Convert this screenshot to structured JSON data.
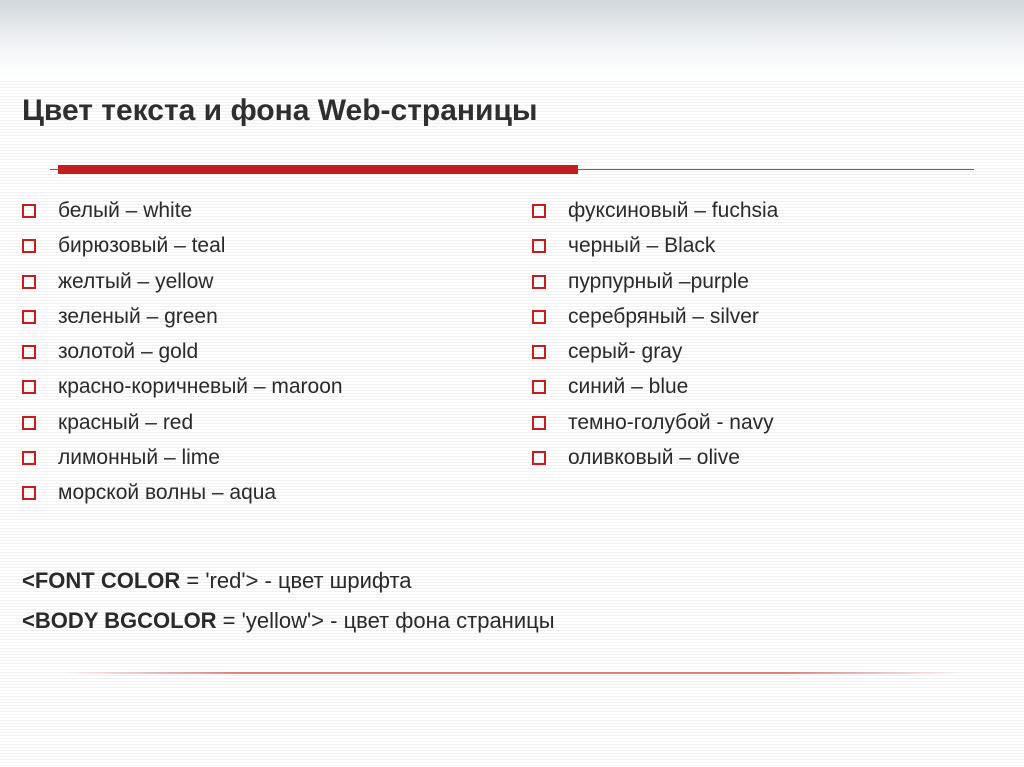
{
  "title": "Цвет текста и фона Web-страницы",
  "left_items": [
    "белый – white",
    "бирюзовый – teal",
    "желтый – yellow",
    "зеленый – green",
    "золотой – gold",
    "красно-коричневый – maroon",
    "красный – red",
    "лимонный – lime",
    "морской волны – aqua"
  ],
  "right_items": [
    "фуксиновый – fuchsia",
    "черный – Black",
    "пурпурный –purple",
    "серебряный – silver",
    "серый- gray",
    "синий –  blue",
    "темно-голубой - navy",
    "оливковый – olive"
  ],
  "code1": {
    "bold": "<FONT COLOR",
    "rest": " = 'red'>  - цвет шрифта"
  },
  "code2": {
    "bold": "<BODY BGCOLOR",
    "rest": " = 'yellow'>   - цвет фона страницы"
  }
}
